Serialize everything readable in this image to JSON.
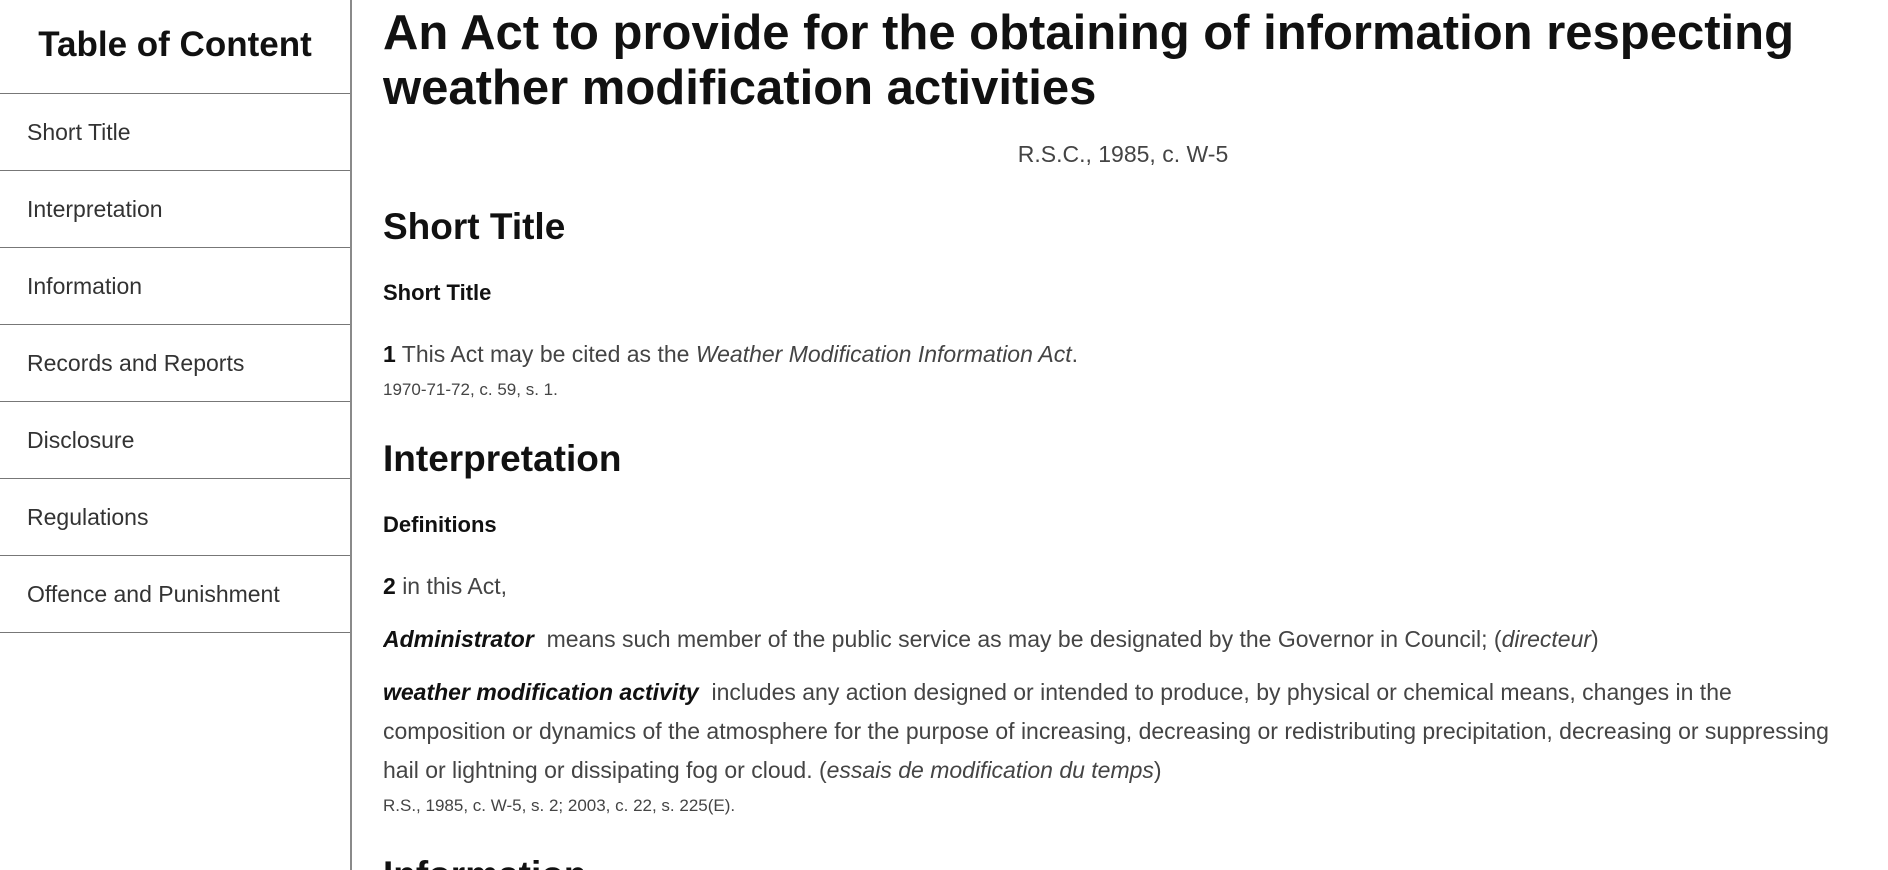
{
  "sidebar": {
    "title": "Table of Content",
    "items": [
      {
        "label": "Short Title"
      },
      {
        "label": "Interpretation"
      },
      {
        "label": "Information"
      },
      {
        "label": "Records and Reports"
      },
      {
        "label": "Disclosure"
      },
      {
        "label": "Regulations"
      },
      {
        "label": "Offence and Punishment"
      }
    ]
  },
  "document": {
    "title": "An Act to provide for the obtaining of information respecting weather modification activities",
    "citation": "R.S.C., 1985, c. W-5",
    "short_title_section": {
      "heading": "Short Title",
      "subheading": "Short Title",
      "section_number": "1",
      "text_before": "This Act may be cited as the",
      "act_name": "Weather Modification Information Act",
      "text_after": ".",
      "history": "1970-71-72, c. 59, s. 1."
    },
    "interpretation_section": {
      "heading": "Interpretation",
      "subheading": "Definitions",
      "section_number": "2",
      "intro": "in this Act,",
      "definitions": [
        {
          "term": "Administrator",
          "text": "means such member of the public service as may be designated by the Governor in Council;  (",
          "french": "directeur",
          "close": ")"
        },
        {
          "term": "weather modification activity",
          "text": "includes any action designed or intended to produce, by physical or chemical means, changes in the composition or dynamics of the atmosphere for the purpose of increasing, decreasing or redistributing precipitation, decreasing or suppressing hail or lightning or dissipating fog or cloud.  (",
          "french": "essais de modification du temps",
          "close": ")"
        }
      ],
      "history": "R.S., 1985, c. W-5, s. 2; 2003, c. 22, s. 225(E)."
    },
    "information_section": {
      "heading": "Information"
    }
  }
}
